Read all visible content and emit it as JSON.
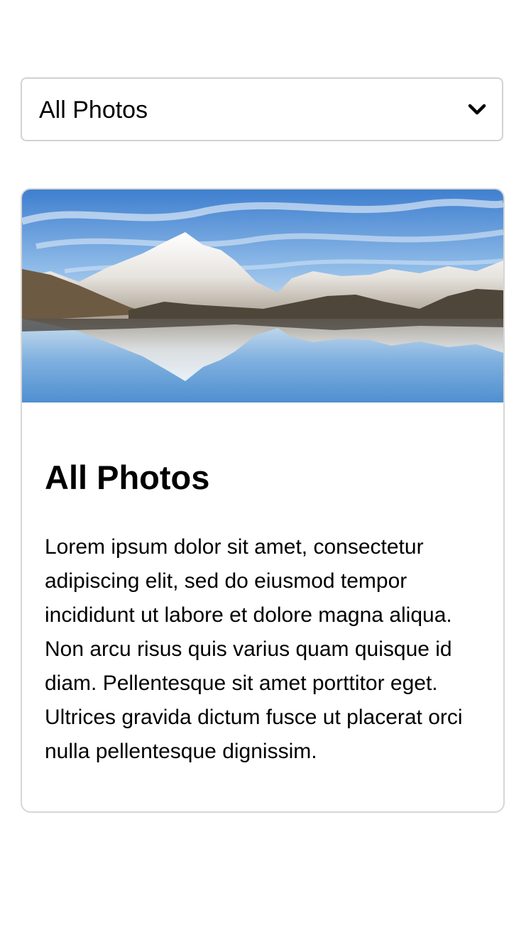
{
  "filter": {
    "selected_label": "All Photos",
    "icon": "chevron-down-icon"
  },
  "card": {
    "image_subject": "mountain-lake-reflection",
    "title": "All Photos",
    "body": "Lorem ipsum dolor sit amet, consectetur adipiscing elit, sed do eiusmod tempor incididunt ut labore et dolore magna aliqua. Non arcu risus quis varius quam quisque id diam. Pellentesque sit amet porttitor eget. Ultrices gravida dictum fusce ut placerat orci nulla pellentesque dignissim."
  },
  "colors": {
    "border": "#d2d2d2",
    "text": "#000000",
    "sky": "#4d8fd6",
    "water": "#6fa8dc"
  }
}
